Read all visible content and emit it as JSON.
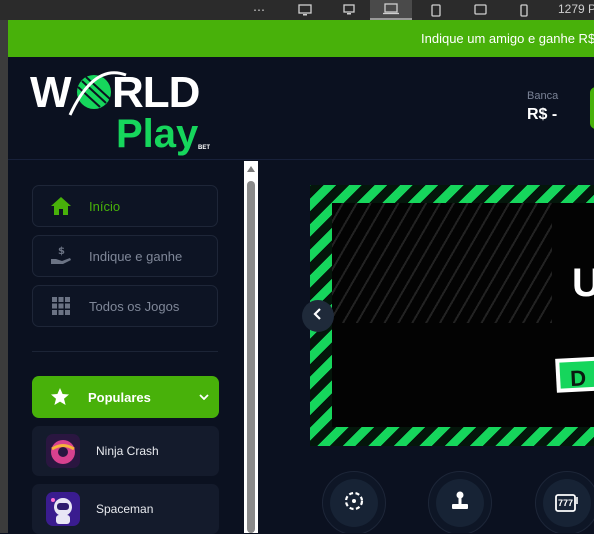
{
  "devtools": {
    "more_label": "⋯",
    "resolution": "1279 P"
  },
  "promo": {
    "text": "Indique um amigo e ganhe R$"
  },
  "header": {
    "logo_alt": "World Play Bet",
    "banca_label": "Banca",
    "banca_value": "R$ -"
  },
  "sidebar": {
    "nav": [
      {
        "label": "Início",
        "icon": "home-icon",
        "active": true
      },
      {
        "label": "Indique e ganhe",
        "icon": "money-hand-icon",
        "active": false
      },
      {
        "label": "Todos os Jogos",
        "icon": "grid-icon",
        "active": false
      }
    ],
    "popular_label": "Populares",
    "games": [
      {
        "label": "Ninja Crash",
        "icon": "ninja-crash-thumb"
      },
      {
        "label": "Spaceman",
        "icon": "spaceman-thumb"
      }
    ]
  },
  "banner": {
    "headline_partial": "U",
    "tag_partial": "D"
  },
  "categories": [
    {
      "icon": "roulette-icon"
    },
    {
      "icon": "joystick-icon"
    },
    {
      "icon": "slot-777-icon",
      "text": "777"
    }
  ],
  "colors": {
    "accent": "#48b10a",
    "banner_green": "#16d65c",
    "background": "#0b1120"
  }
}
